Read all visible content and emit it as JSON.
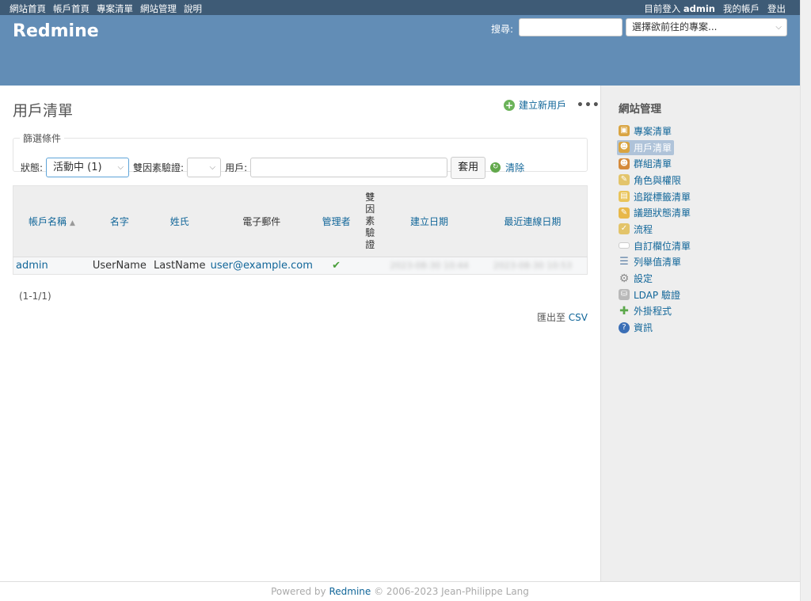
{
  "top_menu": {
    "left": [
      "網站首頁",
      "帳戶首頁",
      "專案清單",
      "網站管理",
      "說明"
    ],
    "logged_as_label": "目前登入",
    "user": "admin",
    "my_account": "我的帳戶",
    "logout": "登出"
  },
  "header": {
    "app_title": "Redmine",
    "search_label": "搜尋:",
    "search_value": "",
    "jump_placeholder": "選擇欲前往的專案..."
  },
  "content": {
    "title": "用戶清單",
    "new_user": "建立新用戶",
    "more": "•••",
    "filters": {
      "legend": "篩選條件",
      "status_label": "狀態:",
      "status_value": "活動中 (1)",
      "twofa_label": "雙因素驗證:",
      "twofa_value": "",
      "user_label": "用戶:",
      "user_value": "",
      "apply": "套用",
      "clear": "清除"
    },
    "table": {
      "headers": {
        "login": "帳戶名稱",
        "firstname": "名字",
        "lastname": "姓氏",
        "mail": "電子郵件",
        "admin": "管理者",
        "twofa": "雙因素驗證",
        "created_on": "建立日期",
        "last_login_on": "最近連線日期"
      },
      "rows": [
        {
          "login": "admin",
          "firstname": "UserName",
          "lastname": "LastName",
          "mail": "user@example.com",
          "admin": "✔",
          "twofa": "",
          "created_on": "2023-08-30 10:44",
          "last_login_on": "2023-08-30 10:53"
        }
      ]
    },
    "pagination": "(1-1/1)",
    "export_label": "匯出至",
    "export_csv": "CSV"
  },
  "sidebar": {
    "title": "網站管理",
    "items": [
      {
        "label": "專案清單",
        "icon": "projects-icon",
        "color": "#d9a441"
      },
      {
        "label": "用戶清單",
        "icon": "user-icon",
        "color": "#d9a441",
        "selected": true
      },
      {
        "label": "群組清單",
        "icon": "group-icon",
        "color": "#d58a3b"
      },
      {
        "label": "角色與權限",
        "icon": "roles-icon",
        "color": "#e3c46a"
      },
      {
        "label": "追蹤標籤清單",
        "icon": "trackers-icon",
        "color": "#e9c45a"
      },
      {
        "label": "議題狀態清單",
        "icon": "issue-status-icon",
        "color": "#e8b84a"
      },
      {
        "label": "流程",
        "icon": "workflow-icon",
        "color": "#e3c46a"
      },
      {
        "label": "自訂欄位清單",
        "icon": "custom-fields-icon",
        "color": "#ffffff"
      },
      {
        "label": "列舉值清單",
        "icon": "list-icon",
        "color": "#5b7fa6"
      },
      {
        "label": "設定",
        "icon": "gear-icon",
        "color": "#8a8a8a"
      },
      {
        "label": "LDAP 驗證",
        "icon": "ldap-icon",
        "color": "#b9b9b9"
      },
      {
        "label": "外掛程式",
        "icon": "plugin-icon",
        "color": "#5ba84a"
      },
      {
        "label": "資訊",
        "icon": "info-icon",
        "color": "#3b6fb6"
      }
    ]
  },
  "footer": {
    "powered_by": "Powered by",
    "product": "Redmine",
    "copyright": "© 2006-2023 Jean-Philippe Lang"
  }
}
